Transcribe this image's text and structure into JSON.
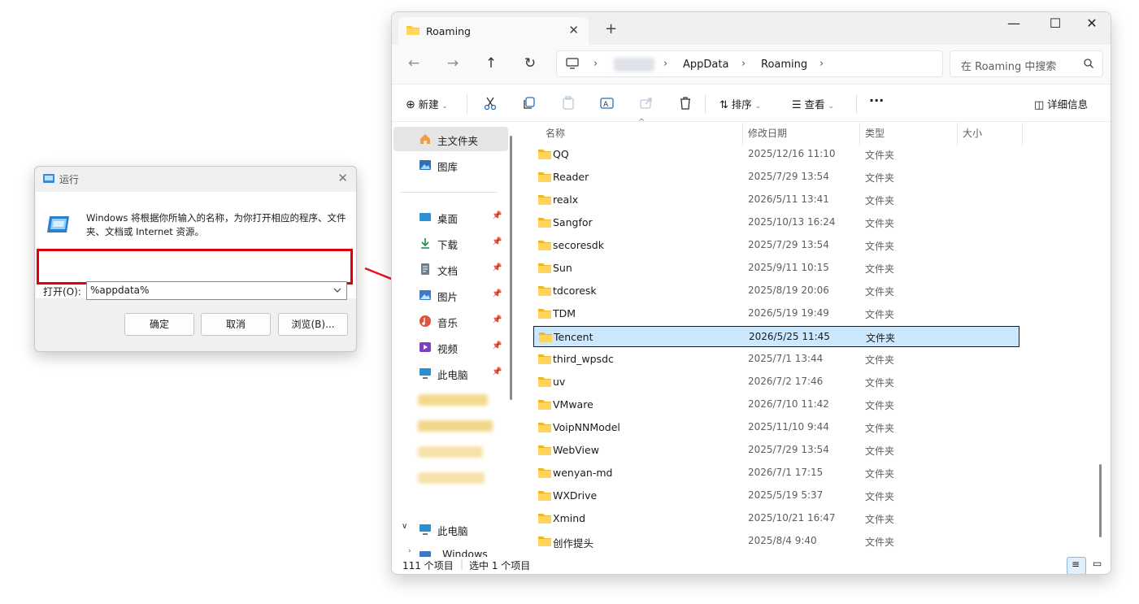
{
  "run_dialog": {
    "title": "运行",
    "description": "Windows 将根据你所输入的名称，为你打开相应的程序、文件夹、文档或 Internet 资源。",
    "open_label": "打开(O):",
    "command_value": "%appdata%",
    "ok_label": "确定",
    "cancel_label": "取消",
    "browse_label": "浏览(B)...",
    "highlight_color": "#e0000b"
  },
  "explorer": {
    "tab_title": "Roaming",
    "breadcrumbs": [
      "AppData",
      "Roaming"
    ],
    "search_placeholder": "在 Roaming 中搜索",
    "toolbar": {
      "new_label": "新建",
      "sort_label": "排序",
      "view_label": "查看",
      "more_label": "···",
      "details_label": "详细信息"
    },
    "sidebar": {
      "home": "主文件夹",
      "gallery": "图库",
      "quick": [
        {
          "label": "桌面",
          "icon": "desktop-icon"
        },
        {
          "label": "下载",
          "icon": "download-icon"
        },
        {
          "label": "文档",
          "icon": "document-icon"
        },
        {
          "label": "图片",
          "icon": "pictures-icon"
        },
        {
          "label": "音乐",
          "icon": "music-icon"
        },
        {
          "label": "视频",
          "icon": "video-icon"
        },
        {
          "label": "此电脑",
          "icon": "computer-icon"
        }
      ],
      "this_pc": "此电脑",
      "drive_partial": "Windows (C:)"
    },
    "columns": {
      "name": "名称",
      "date": "修改日期",
      "type": "类型",
      "size": "大小"
    },
    "files": [
      {
        "name": "QQ",
        "date": "2025/12/16 11:10",
        "type": "文件夹"
      },
      {
        "name": "Reader",
        "date": "2025/7/29 13:54",
        "type": "文件夹"
      },
      {
        "name": "realx",
        "date": "2026/5/11 13:41",
        "type": "文件夹"
      },
      {
        "name": "Sangfor",
        "date": "2025/10/13 16:24",
        "type": "文件夹"
      },
      {
        "name": "secoresdk",
        "date": "2025/7/29 13:54",
        "type": "文件夹"
      },
      {
        "name": "Sun",
        "date": "2025/9/11 10:15",
        "type": "文件夹"
      },
      {
        "name": "tdcoresk",
        "date": "2025/8/19 20:06",
        "type": "文件夹"
      },
      {
        "name": "TDM",
        "date": "2026/5/19 19:49",
        "type": "文件夹"
      },
      {
        "name": "Tencent",
        "date": "2026/5/25 11:45",
        "type": "文件夹",
        "selected": true
      },
      {
        "name": "third_wpsdc",
        "date": "2025/7/1 13:44",
        "type": "文件夹"
      },
      {
        "name": "uv",
        "date": "2026/7/2 17:46",
        "type": "文件夹"
      },
      {
        "name": "VMware",
        "date": "2026/7/10 11:42",
        "type": "文件夹"
      },
      {
        "name": "VoipNNModel",
        "date": "2025/11/10 9:44",
        "type": "文件夹"
      },
      {
        "name": "WebView",
        "date": "2025/7/29 13:54",
        "type": "文件夹"
      },
      {
        "name": "wenyan-md",
        "date": "2026/7/1 17:15",
        "type": "文件夹"
      },
      {
        "name": "WXDrive",
        "date": "2025/5/19 5:37",
        "type": "文件夹"
      },
      {
        "name": "Xmind",
        "date": "2025/10/21 16:47",
        "type": "文件夹"
      },
      {
        "name": "创作提头",
        "date": "2025/8/4 9:40",
        "type": "文件夹"
      }
    ],
    "status": {
      "count": "111 个项目",
      "selection": "选中 1 个项目"
    },
    "colors": {
      "selection_bg": "#cce8ff",
      "folder": "#f8c63c",
      "annotation_red": "#e8141c"
    }
  }
}
